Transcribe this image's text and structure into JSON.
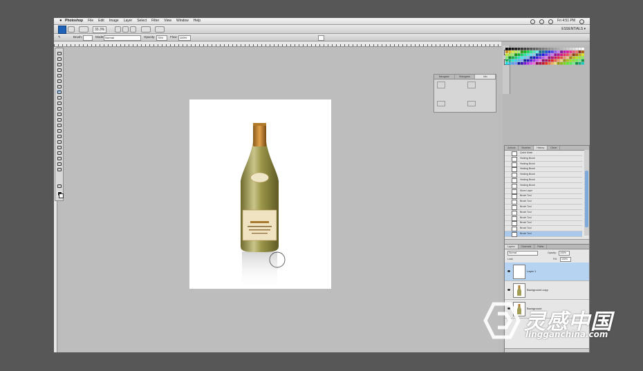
{
  "menubar": {
    "menus": [
      "Photoshop",
      "File",
      "Edit",
      "Image",
      "Layer",
      "Select",
      "Filter",
      "View",
      "Window",
      "Help"
    ],
    "clock": "Fri 4:51 PM"
  },
  "appbar": {
    "zoom": "33.3%",
    "workspace": "ESSENTIALS ▾"
  },
  "options": {
    "brush_label": "Brush:",
    "mode_label": "Mode:",
    "mode_value": "Normal",
    "opacity_label": "Opacity:",
    "opacity_value": "75%",
    "flow_label": "Flow:",
    "flow_value": "100%"
  },
  "info_panel": {
    "tabs": [
      "Navigator",
      "Histogram",
      "Info"
    ],
    "active_tab": 2
  },
  "history_panel": {
    "tabs": [
      "Actions",
      "Brushes",
      "History",
      "Clone"
    ],
    "items": [
      "Quick Mask",
      "Healing Brush",
      "Healing Brush",
      "Healing Brush",
      "Healing Brush",
      "Healing Brush",
      "Healing Brush",
      "Move Layer",
      "Brush Tool",
      "Brush Tool",
      "Brush Tool",
      "Brush Tool",
      "Brush Tool",
      "Brush Tool",
      "Brush Tool",
      "Brush Tool"
    ],
    "selected_index": 15
  },
  "layers_panel": {
    "tabs": [
      "Layers",
      "Channels",
      "Paths"
    ],
    "blend_mode": "Normal",
    "opacity_label": "Opacity:",
    "opacity_value": "100%",
    "lock_label": "Lock:",
    "fill_label": "Fill:",
    "fill_value": "100%",
    "layers": [
      {
        "name": "Layer 1",
        "selected": true
      },
      {
        "name": "Background copy",
        "selected": false
      },
      {
        "name": "Background",
        "selected": false
      }
    ]
  },
  "colors": {
    "selection_blue": "#b6d3f1",
    "ps_blue": "#1f62b8"
  },
  "watermark": {
    "chinese": "灵感中国",
    "url": "lingganchina.com"
  }
}
